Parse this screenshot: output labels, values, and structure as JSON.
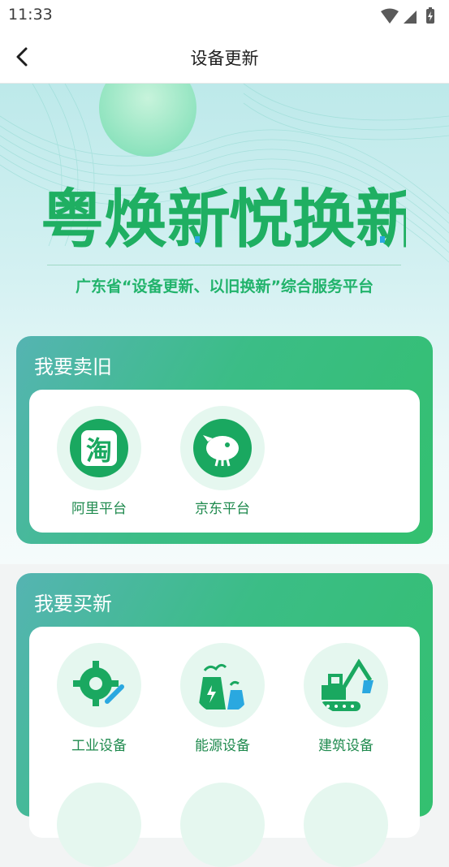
{
  "status": {
    "time": "11:33"
  },
  "nav": {
    "title": "设备更新"
  },
  "hero": {
    "logo_left": "粤焕新",
    "logo_right": "悦换新",
    "tagline": "广东省“设备更新、以旧换新”综合服务平台"
  },
  "sell": {
    "title": "我要卖旧",
    "items": [
      {
        "label": "阿里平台",
        "icon": "taobao-icon",
        "glyph": "淘"
      },
      {
        "label": "京东平台",
        "icon": "jd-dog-icon"
      }
    ]
  },
  "buy": {
    "title": "我要买新",
    "items": [
      {
        "label": "工业设备",
        "icon": "gear-wrench-icon"
      },
      {
        "label": "能源设备",
        "icon": "power-plant-icon"
      },
      {
        "label": "建筑设备",
        "icon": "excavator-icon"
      }
    ]
  },
  "colors": {
    "brand_green": "#21b36b",
    "brand_blue": "#2aa8e0",
    "icon_bg": "#e5f7ef"
  }
}
